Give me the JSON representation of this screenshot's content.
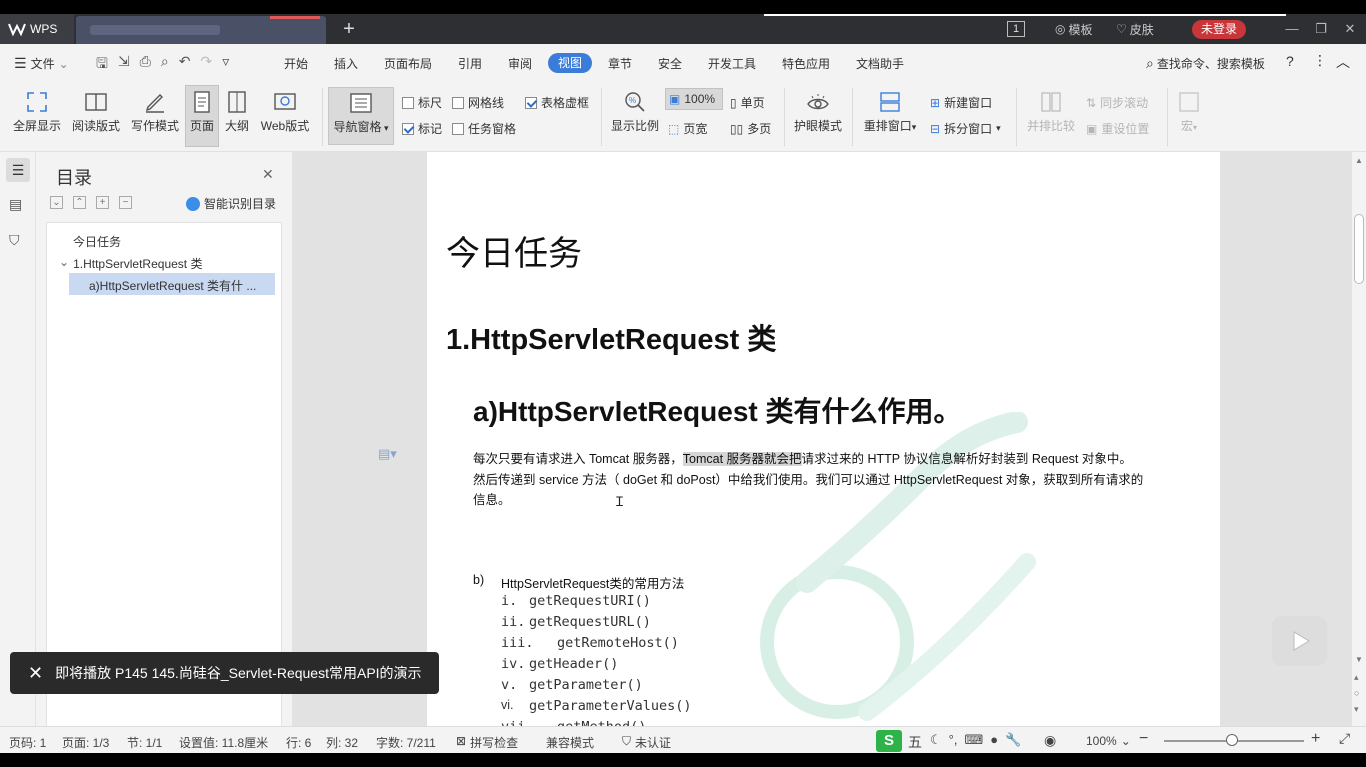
{
  "titlebar": {
    "app_name": "WPS",
    "page_counter": "1",
    "templates": "模板",
    "skin": "皮肤",
    "login": "未登录"
  },
  "menu": {
    "file": "文件",
    "items": [
      "开始",
      "插入",
      "页面布局",
      "引用",
      "审阅",
      "视图",
      "章节",
      "安全",
      "开发工具",
      "特色应用",
      "文档助手"
    ],
    "search": "查找命令、搜索模板"
  },
  "ribbon": {
    "fullscreen": "全屏显示",
    "reading": "阅读版式",
    "writing": "写作模式",
    "page": "页面",
    "outline": "大纲",
    "web": "Web版式",
    "nav_pane": "导航窗格",
    "ruler": "标尺",
    "gridlines": "网格线",
    "table_gridlines": "表格虚框",
    "marks": "标记",
    "task_pane": "任务窗格",
    "zoom_ratio": "显示比例",
    "zoom_100": "100%",
    "page_width": "页宽",
    "single_page": "单页",
    "multi_page": "多页",
    "eye_mode": "护眼模式",
    "arrange": "重排窗口",
    "new_window": "新建窗口",
    "split_window": "拆分窗口",
    "side_by_side": "并排比较",
    "sync_scroll": "同步滚动",
    "reset_position": "重设位置",
    "macro": "宏"
  },
  "nav": {
    "title": "目录",
    "smart_toc": "智能识别目录",
    "items": [
      "今日任务",
      "1.HttpServletRequest 类",
      "a)HttpServletRequest 类有什 ..."
    ]
  },
  "document": {
    "h1": "今日任务",
    "h2": "1.HttpServletRequest 类",
    "h3": "a)HttpServletRequest 类有什么作用。",
    "para_line1_a": "每次只要有请求进入 Tomcat 服务器，",
    "para_line1_hl": "Tomcat 服务器就会把",
    "para_line1_b": "请求过来的 HTTP 协议信息解析好封装到 Request 对象中。",
    "para_line2": "然后传递到 service 方法（ doGet 和 doPost）中给我们使用。我们可以通过 HttpServletRequest 对象，获取到所有请求的",
    "para_line3": "信息。",
    "list_b_num": "b)",
    "list_b": "HttpServletRequest类的常用方法",
    "methods": [
      {
        "num": "i.",
        "name": "getRequestURI()"
      },
      {
        "num": "ii.",
        "name": "getRequestURL()"
      },
      {
        "num": "iii.",
        "name": "getRemoteHost()"
      },
      {
        "num": "iv.",
        "name": "getHeader()"
      },
      {
        "num": "v.",
        "name": "getParameter()"
      },
      {
        "num": "vi.",
        "name": "getParameterValues()"
      },
      {
        "num": "vii.",
        "name": "getMethod()"
      }
    ]
  },
  "toast": {
    "text": "即将播放 P145 145.尚硅谷_Servlet-Request常用API的演示"
  },
  "statusbar": {
    "page_num": "页码: 1",
    "page": "页面: 1/3",
    "section": "节: 1/1",
    "setting": "设置值: 11.8厘米",
    "row": "行: 6",
    "col": "列: 32",
    "words": "字数: 7/211",
    "spell": "拼写检查",
    "compat": "兼容模式",
    "cert": "未认证",
    "ime": "五",
    "zoom": "100%"
  },
  "colors": {
    "accent": "#3b7cd8",
    "login": "#c8363a",
    "titlebar": "#2e2f33"
  }
}
